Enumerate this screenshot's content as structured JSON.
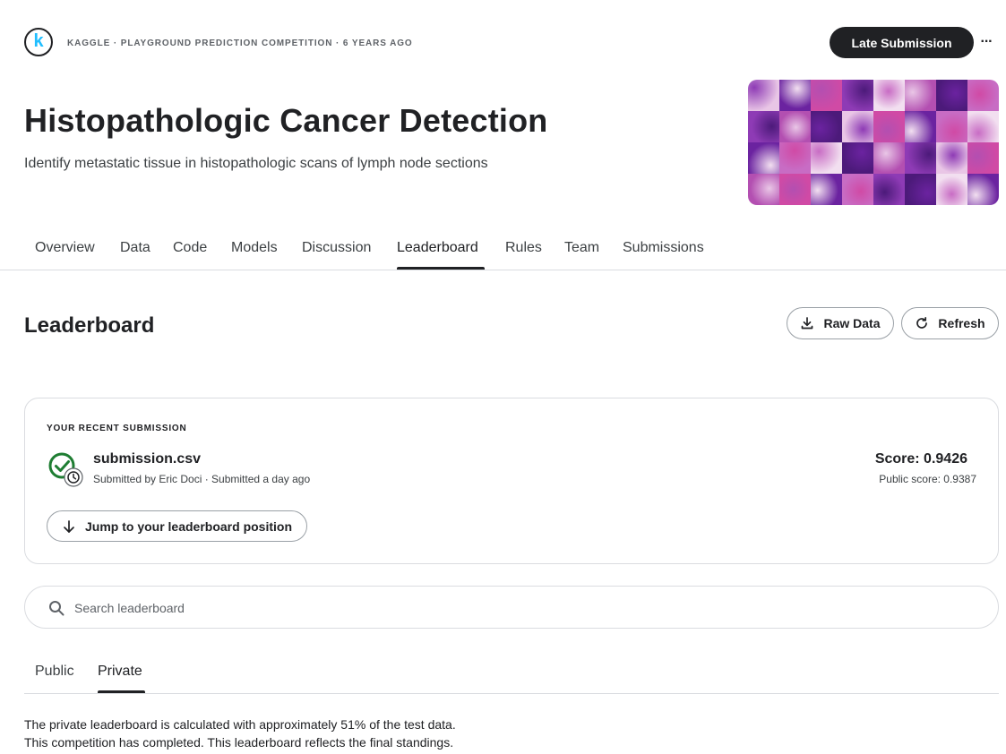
{
  "header": {
    "logo_letter": "k",
    "breadcrumb": "KAGGLE · PLAYGROUND PREDICTION COMPETITION · 6 YEARS AGO",
    "late_submission_label": "Late Submission",
    "more_icon": "more-horizontal-icon",
    "more_label": "···"
  },
  "competition": {
    "title": "Histopathologic Cancer Detection",
    "subtitle": "Identify metastatic tissue in histopathologic scans of lymph node sections"
  },
  "nav": {
    "tabs": [
      {
        "label": "Overview"
      },
      {
        "label": "Data"
      },
      {
        "label": "Code"
      },
      {
        "label": "Models"
      },
      {
        "label": "Discussion"
      },
      {
        "label": "Leaderboard"
      },
      {
        "label": "Rules"
      },
      {
        "label": "Team"
      },
      {
        "label": "Submissions"
      }
    ],
    "active": "Leaderboard"
  },
  "leaderboard": {
    "title": "Leaderboard",
    "raw_data_label": "Raw Data",
    "refresh_label": "Refresh",
    "download_icon": "download-icon",
    "refresh_icon": "refresh-icon"
  },
  "recent_submission": {
    "section_label": "YOUR RECENT SUBMISSION",
    "file_name": "submission.csv",
    "submitted_text": "Submitted by Eric Doci · Submitted a day ago",
    "score_text": "Score: 0.9426",
    "public_score_text": "Public score: 0.9387",
    "jump_label": "Jump to your leaderboard position",
    "status_icon": "check-circle-clock-icon"
  },
  "search": {
    "placeholder": "Search leaderboard",
    "value": ""
  },
  "board_tabs": {
    "tabs": [
      {
        "label": "Public"
      },
      {
        "label": "Private"
      }
    ],
    "active": "Private"
  },
  "notes": {
    "line1": "The private leaderboard is calculated with approximately 51% of the test data.",
    "line2": "This competition has completed. This leaderboard reflects the final standings."
  },
  "colors": {
    "accent": "#20beff",
    "primary_button": "#202124",
    "success_green": "#1e7d32",
    "banner_palette": [
      "#e9c6e6",
      "#6b23a0",
      "#d04aa5",
      "#8e3bb5",
      "#f2dff0",
      "#b34fb1",
      "#4c1a7a",
      "#c86cc4"
    ]
  }
}
